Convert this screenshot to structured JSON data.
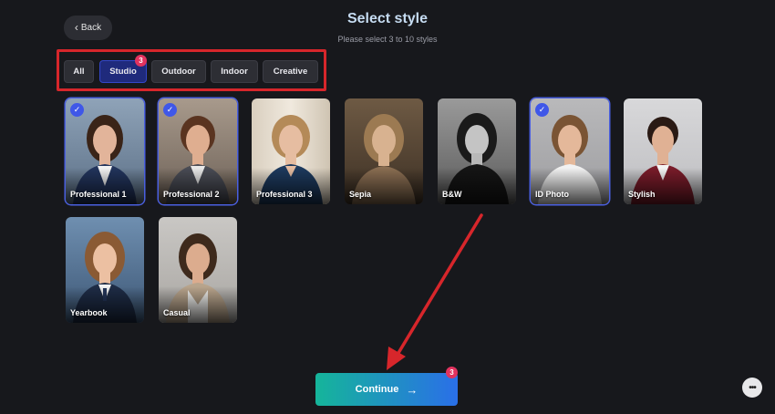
{
  "header": {
    "back_label": "Back",
    "title": "Select style",
    "subtitle": "Please select 3 to 10 styles"
  },
  "filters": [
    {
      "label": "All",
      "active": false
    },
    {
      "label": "Studio",
      "active": true,
      "badge": "3"
    },
    {
      "label": "Outdoor",
      "active": false
    },
    {
      "label": "Indoor",
      "active": false
    },
    {
      "label": "Creative",
      "active": false
    }
  ],
  "styles": [
    {
      "label": "Professional 1",
      "selected": true
    },
    {
      "label": "Professional 2",
      "selected": true
    },
    {
      "label": "Professional 3",
      "selected": false
    },
    {
      "label": "Sepia",
      "selected": false
    },
    {
      "label": "B&W",
      "selected": false
    },
    {
      "label": "ID Photo",
      "selected": true
    },
    {
      "label": "Stylish",
      "selected": false
    },
    {
      "label": "Yearbook",
      "selected": false
    },
    {
      "label": "Casual",
      "selected": false
    }
  ],
  "continue": {
    "label": "Continue",
    "badge": "3"
  },
  "colors": {
    "background": "#17181c",
    "accent": "#3f57e8",
    "badge": "#e2335f",
    "highlight": "#d7262b",
    "continue_start": "#15b59a",
    "continue_end": "#2a6fe8"
  }
}
